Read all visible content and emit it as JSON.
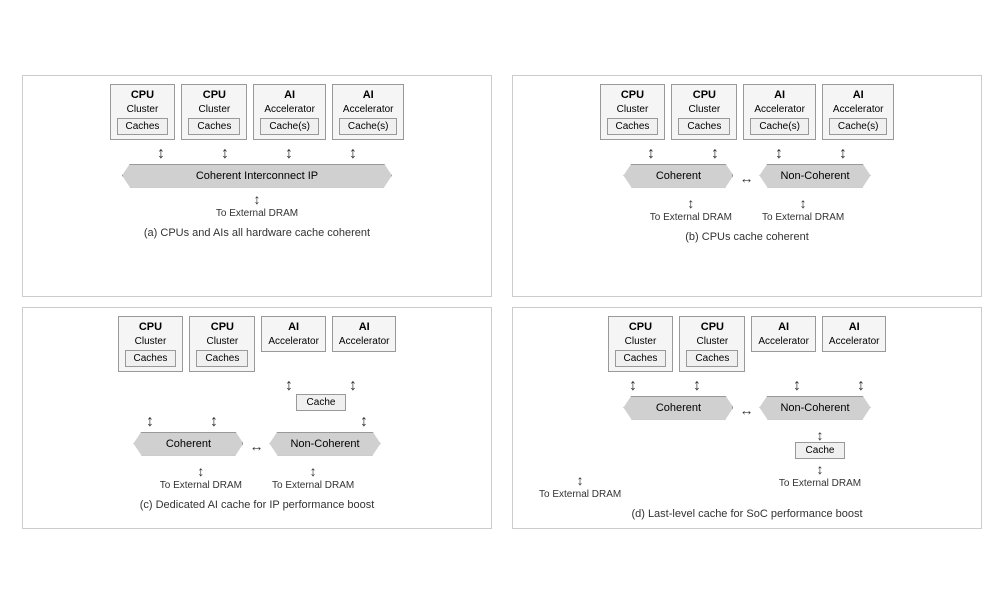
{
  "diagrams": {
    "a": {
      "title": "(a) CPUs and AIs all hardware cache coherent",
      "components": [
        {
          "type": "CPU",
          "subtitle": "Cluster",
          "cache": "Caches"
        },
        {
          "type": "CPU",
          "subtitle": "Cluster",
          "cache": "Caches"
        },
        {
          "type": "AI",
          "subtitle": "Accelerator",
          "cache": "Cache(s)"
        },
        {
          "type": "AI",
          "subtitle": "Accelerator",
          "cache": "Cache(s)"
        }
      ],
      "interconnect": "Coherent Interconnect IP",
      "dram": [
        "To External DRAM"
      ]
    },
    "b": {
      "title": "(b) CPUs cache coherent",
      "components": [
        {
          "type": "CPU",
          "subtitle": "Cluster",
          "cache": "Caches"
        },
        {
          "type": "CPU",
          "subtitle": "Cluster",
          "cache": "Caches"
        },
        {
          "type": "AI",
          "subtitle": "Accelerator",
          "cache": "Cache(s)"
        },
        {
          "type": "AI",
          "subtitle": "Accelerator",
          "cache": "Cache(s)"
        }
      ],
      "coherent": "Coherent",
      "noncoherent": "Non-Coherent",
      "dram": [
        "To External DRAM",
        "To External DRAM"
      ]
    },
    "c": {
      "title": "(c) Dedicated AI cache for IP performance boost",
      "components": [
        {
          "type": "CPU",
          "subtitle": "Cluster",
          "cache": "Caches"
        },
        {
          "type": "CPU",
          "subtitle": "Cluster",
          "cache": "Caches"
        },
        {
          "type": "AI",
          "subtitle": "Accelerator",
          "cache": null
        },
        {
          "type": "AI",
          "subtitle": "Accelerator",
          "cache": null
        }
      ],
      "coherent": "Coherent",
      "noncoherent": "Non-Coherent",
      "ai_cache": "Cache",
      "dram": [
        "To External DRAM",
        "To External DRAM"
      ]
    },
    "d": {
      "title": "(d) Last-level cache for SoC performance boost",
      "components": [
        {
          "type": "CPU",
          "subtitle": "Cluster",
          "cache": "Caches"
        },
        {
          "type": "CPU",
          "subtitle": "Cluster",
          "cache": "Caches"
        },
        {
          "type": "AI",
          "subtitle": "Accelerator",
          "cache": null
        },
        {
          "type": "AI",
          "subtitle": "Accelerator",
          "cache": null
        }
      ],
      "coherent": "Coherent",
      "noncoherent": "Non-Coherent",
      "llc_cache": "Cache",
      "dram": [
        "To External DRAM",
        "To External DRAM"
      ]
    }
  }
}
